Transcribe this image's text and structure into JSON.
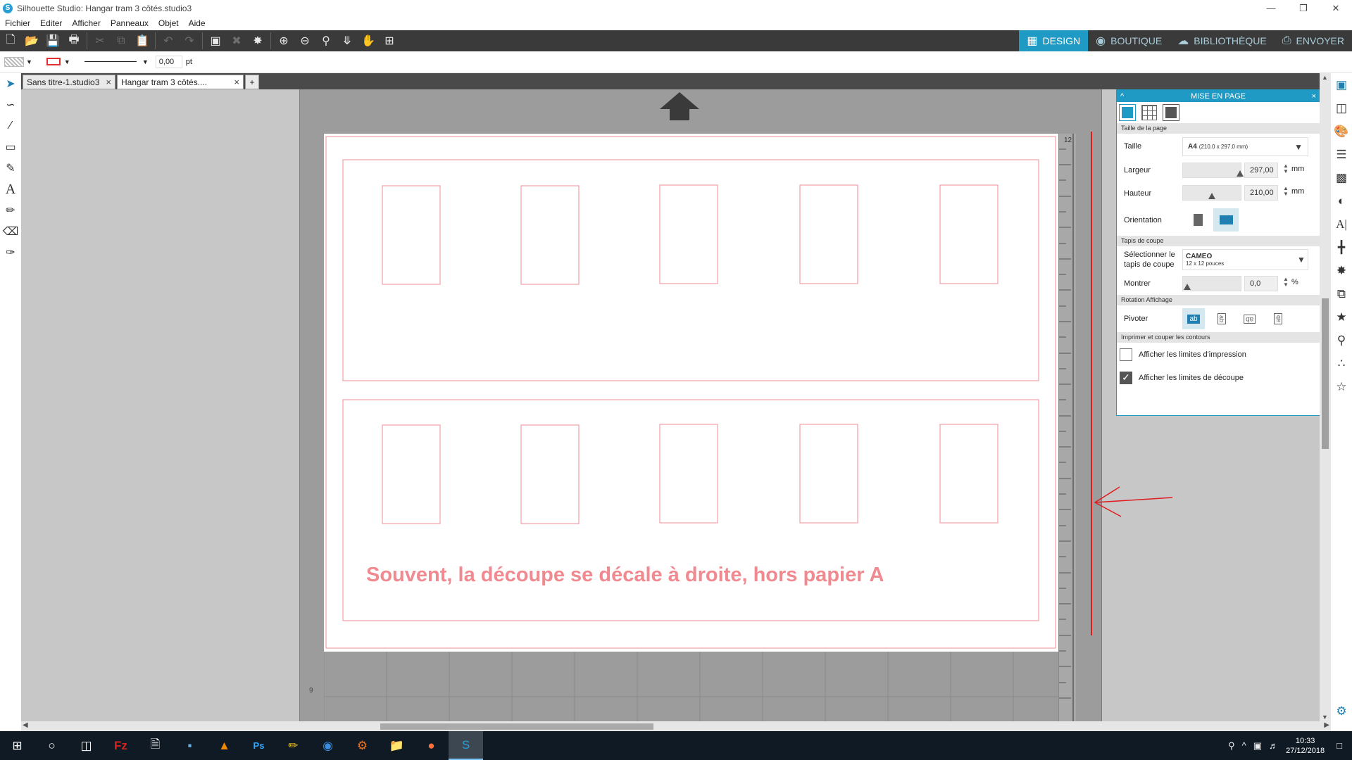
{
  "window": {
    "title": "Silhouette Studio: Hangar tram 3 côtés.studio3",
    "app_icon": "S"
  },
  "menu": [
    "Fichier",
    "Editer",
    "Afficher",
    "Panneaux",
    "Objet",
    "Aide"
  ],
  "mode_tabs": [
    {
      "label": "DESIGN",
      "icon": "grid-icon",
      "active": true
    },
    {
      "label": "BOUTIQUE",
      "icon": "store-icon",
      "active": false
    },
    {
      "label": "BIBLIOTHÈQUE",
      "icon": "cloud-icon",
      "active": false
    },
    {
      "label": "ENVOYER",
      "icon": "machine-icon",
      "active": false
    }
  ],
  "propbar": {
    "line_width": "0,00",
    "unit": "pt"
  },
  "doc_tabs": [
    {
      "label": "Sans titre-1.studio3",
      "close": "×"
    },
    {
      "label": "Hangar tram 3 côtés....",
      "close": "×"
    }
  ],
  "doc_tab_add": "+",
  "canvas": {
    "annotation": "Souvent, la découpe se décale à droite, hors papier A",
    "ruler_top": "12",
    "ruler_bottom": "9",
    "cut_color": "#f2a0a6",
    "annotation_color": "#f08a90",
    "red_line_color": "#e01b1b"
  },
  "panel": {
    "title": "MISE EN PAGE",
    "collapse": "^",
    "close": "×",
    "sections": {
      "page_size": "Taille de la page",
      "cut_mat": "Tapis de coupe",
      "rotation": "Rotation Affichage",
      "print_cut": "Imprimer et couper les contours"
    },
    "size_label": "Taille",
    "size_value": "A4",
    "size_detail": "(210.0 x 297.0 mm)",
    "width_label": "Largeur",
    "width_value": "297,00",
    "width_unit": "mm",
    "height_label": "Hauteur",
    "height_value": "210,00",
    "height_unit": "mm",
    "orientation_label": "Orientation",
    "mat_label": "Sélectionner le tapis de coupe",
    "mat_value": "CAMEO",
    "mat_detail": "12 x 12 pouces",
    "show_label": "Montrer",
    "show_value": "0,0",
    "show_unit": "%",
    "pivot_label": "Pivoter",
    "pivot_options": [
      "ab",
      "ab",
      "ab",
      "ab"
    ],
    "checkboxes": [
      {
        "label": "Afficher les limites d'impression",
        "checked": false
      },
      {
        "label": "Afficher les limites de découpe",
        "checked": true
      }
    ]
  },
  "taskbar": {
    "time": "10:33",
    "date": "27/12/2018"
  }
}
